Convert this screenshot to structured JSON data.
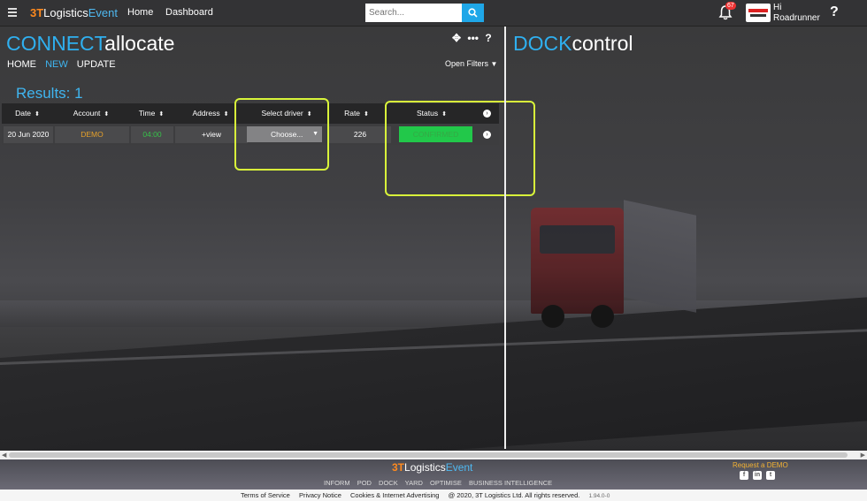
{
  "topbar": {
    "brand_3t": "3T",
    "brand_logistics": "Logistics",
    "brand_event": "Event",
    "nav": [
      "Home",
      "Dashboard"
    ],
    "search_placeholder": "Search...",
    "notification_count": "67",
    "user_greeting": "Hi",
    "user_name": "Roadrunner",
    "help": "?"
  },
  "left_panel": {
    "title_a": "CONNECT",
    "title_b": "allocate",
    "subnav": [
      "HOME",
      "NEW",
      "UPDATE"
    ],
    "active_subnav": "NEW",
    "tools": [
      "move-icon",
      "more-icon",
      "help-icon"
    ],
    "open_filters": "Open Filters",
    "results": "Results: 1"
  },
  "right_panel": {
    "title_a": "DOCK",
    "title_b": "control"
  },
  "table": {
    "columns": [
      "Date",
      "Account",
      "Time",
      "Address",
      "Select driver",
      "Rate",
      "Status"
    ],
    "row": {
      "date": "20 Jun 2020",
      "account": "DEMO",
      "time": "04:00",
      "address": "+view",
      "driver": "Choose...",
      "rate": "226",
      "status": "CONFIRMED"
    }
  },
  "footer": {
    "brand_3t": "3T",
    "brand_logistics": "Logistics",
    "brand_event": "Event",
    "links": [
      "INFORM",
      "POD",
      "DOCK",
      "YARD",
      "OPTIMISE",
      "BUSINESS INTELLIGENCE"
    ],
    "request_demo": "Request a DEMO",
    "social": [
      "facebook-icon",
      "linkedin-icon",
      "twitter-icon"
    ],
    "bottom_links": [
      "Terms of Service",
      "Privacy Notice",
      "Cookies & Internet Advertising",
      "@ 2020, 3T Logistics Ltd. All rights reserved."
    ],
    "version": "1.94.0-0"
  },
  "colors": {
    "accent_blue": "#2fb0f0",
    "confirmed_green": "#22c84a",
    "highlight": "#d9f53a",
    "demo_orange": "#e7a12a"
  }
}
